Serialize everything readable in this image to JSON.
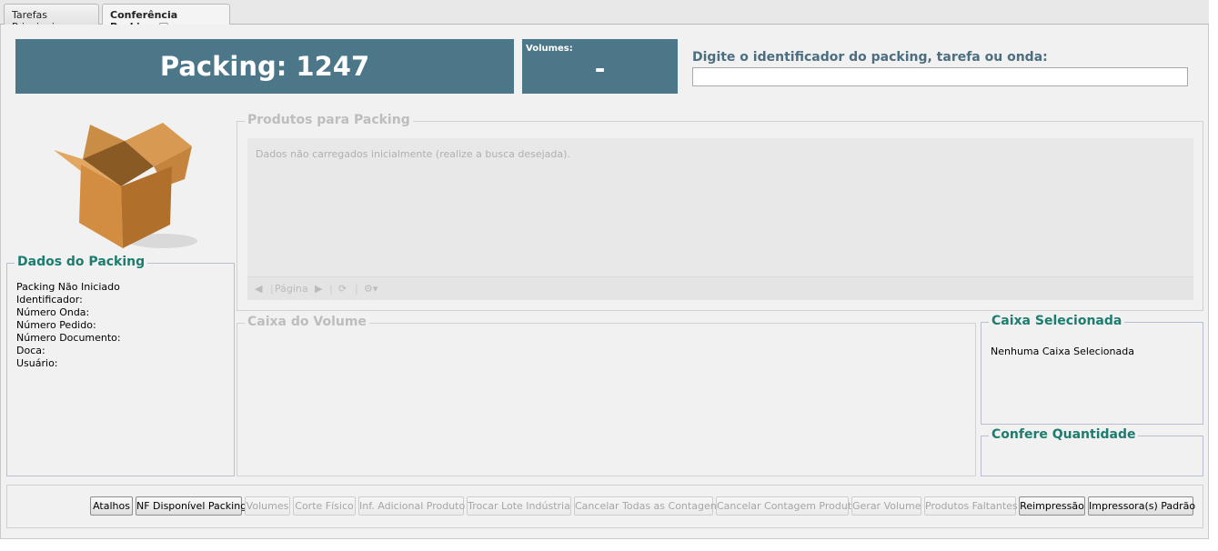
{
  "tabs": [
    {
      "label": "Tarefas Principais"
    },
    {
      "label": "Conferência Packing",
      "close": "×"
    }
  ],
  "header": {
    "packing_title": "Packing: 1247",
    "volumes_label": "Volumes:",
    "volumes_value": "-",
    "search_label": "Digite o identificador do packing, tarefa ou onda:",
    "search_value": ""
  },
  "dados": {
    "legend": "Dados do Packing",
    "lines": [
      "Packing Não Iniciado",
      "Identificador:",
      "Número Onda:",
      "Número Pedido:",
      "Número Documento:",
      "Doca:",
      "Usuário:"
    ]
  },
  "produtos": {
    "legend": "Produtos para Packing",
    "empty_text": "Dados não carregados inicialmente (realize a busca desejada).",
    "pager_label": "Página"
  },
  "caixa_volume": {
    "legend": "Caixa do Volume"
  },
  "caixa_selecionada": {
    "legend": "Caixa Selecionada",
    "text": "Nenhuma Caixa Selecionada"
  },
  "confere": {
    "legend": "Confere Quantidade"
  },
  "toolbar": {
    "buttons": [
      {
        "label": "Atalhos",
        "enabled": true
      },
      {
        "label": "NF Disponível Packing",
        "enabled": true
      },
      {
        "label": "Volumes",
        "enabled": false
      },
      {
        "label": "Corte Físico",
        "enabled": false
      },
      {
        "label": "Inf. Adicional Produto",
        "enabled": false
      },
      {
        "label": "Trocar Lote Indústria",
        "enabled": false
      },
      {
        "label": "Cancelar Todas as Contagens",
        "enabled": false
      },
      {
        "label": "Cancelar Contagem Produto",
        "enabled": false
      },
      {
        "label": "Gerar Volume",
        "enabled": false
      },
      {
        "label": "Produtos Faltantes",
        "enabled": false
      },
      {
        "label": "Reimpressão",
        "enabled": true
      },
      {
        "label": "Impressora(s) Padrão",
        "enabled": true
      }
    ]
  },
  "colors": {
    "header_bg": "#4c7789",
    "legend_teal": "#1c7d6e",
    "search_label": "#4c6e80"
  },
  "icons": [
    "cardboard-box-icon",
    "first-page-icon",
    "next-page-icon",
    "refresh-icon",
    "settings-gear-icon"
  ]
}
